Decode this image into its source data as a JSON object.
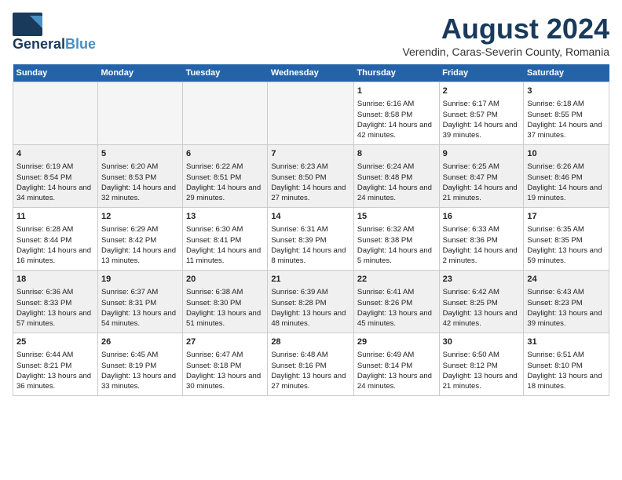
{
  "logo": {
    "general": "General",
    "blue": "Blue"
  },
  "title": "August 2024",
  "subtitle": "Verendin, Caras-Severin County, Romania",
  "days": [
    "Sunday",
    "Monday",
    "Tuesday",
    "Wednesday",
    "Thursday",
    "Friday",
    "Saturday"
  ],
  "weeks": [
    [
      {
        "day": "",
        "content": ""
      },
      {
        "day": "",
        "content": ""
      },
      {
        "day": "",
        "content": ""
      },
      {
        "day": "",
        "content": ""
      },
      {
        "day": "1",
        "content": "Sunrise: 6:16 AM\nSunset: 8:58 PM\nDaylight: 14 hours and 42 minutes."
      },
      {
        "day": "2",
        "content": "Sunrise: 6:17 AM\nSunset: 8:57 PM\nDaylight: 14 hours and 39 minutes."
      },
      {
        "day": "3",
        "content": "Sunrise: 6:18 AM\nSunset: 8:55 PM\nDaylight: 14 hours and 37 minutes."
      }
    ],
    [
      {
        "day": "4",
        "content": "Sunrise: 6:19 AM\nSunset: 8:54 PM\nDaylight: 14 hours and 34 minutes."
      },
      {
        "day": "5",
        "content": "Sunrise: 6:20 AM\nSunset: 8:53 PM\nDaylight: 14 hours and 32 minutes."
      },
      {
        "day": "6",
        "content": "Sunrise: 6:22 AM\nSunset: 8:51 PM\nDaylight: 14 hours and 29 minutes."
      },
      {
        "day": "7",
        "content": "Sunrise: 6:23 AM\nSunset: 8:50 PM\nDaylight: 14 hours and 27 minutes."
      },
      {
        "day": "8",
        "content": "Sunrise: 6:24 AM\nSunset: 8:48 PM\nDaylight: 14 hours and 24 minutes."
      },
      {
        "day": "9",
        "content": "Sunrise: 6:25 AM\nSunset: 8:47 PM\nDaylight: 14 hours and 21 minutes."
      },
      {
        "day": "10",
        "content": "Sunrise: 6:26 AM\nSunset: 8:46 PM\nDaylight: 14 hours and 19 minutes."
      }
    ],
    [
      {
        "day": "11",
        "content": "Sunrise: 6:28 AM\nSunset: 8:44 PM\nDaylight: 14 hours and 16 minutes."
      },
      {
        "day": "12",
        "content": "Sunrise: 6:29 AM\nSunset: 8:42 PM\nDaylight: 14 hours and 13 minutes."
      },
      {
        "day": "13",
        "content": "Sunrise: 6:30 AM\nSunset: 8:41 PM\nDaylight: 14 hours and 11 minutes."
      },
      {
        "day": "14",
        "content": "Sunrise: 6:31 AM\nSunset: 8:39 PM\nDaylight: 14 hours and 8 minutes."
      },
      {
        "day": "15",
        "content": "Sunrise: 6:32 AM\nSunset: 8:38 PM\nDaylight: 14 hours and 5 minutes."
      },
      {
        "day": "16",
        "content": "Sunrise: 6:33 AM\nSunset: 8:36 PM\nDaylight: 14 hours and 2 minutes."
      },
      {
        "day": "17",
        "content": "Sunrise: 6:35 AM\nSunset: 8:35 PM\nDaylight: 13 hours and 59 minutes."
      }
    ],
    [
      {
        "day": "18",
        "content": "Sunrise: 6:36 AM\nSunset: 8:33 PM\nDaylight: 13 hours and 57 minutes."
      },
      {
        "day": "19",
        "content": "Sunrise: 6:37 AM\nSunset: 8:31 PM\nDaylight: 13 hours and 54 minutes."
      },
      {
        "day": "20",
        "content": "Sunrise: 6:38 AM\nSunset: 8:30 PM\nDaylight: 13 hours and 51 minutes."
      },
      {
        "day": "21",
        "content": "Sunrise: 6:39 AM\nSunset: 8:28 PM\nDaylight: 13 hours and 48 minutes."
      },
      {
        "day": "22",
        "content": "Sunrise: 6:41 AM\nSunset: 8:26 PM\nDaylight: 13 hours and 45 minutes."
      },
      {
        "day": "23",
        "content": "Sunrise: 6:42 AM\nSunset: 8:25 PM\nDaylight: 13 hours and 42 minutes."
      },
      {
        "day": "24",
        "content": "Sunrise: 6:43 AM\nSunset: 8:23 PM\nDaylight: 13 hours and 39 minutes."
      }
    ],
    [
      {
        "day": "25",
        "content": "Sunrise: 6:44 AM\nSunset: 8:21 PM\nDaylight: 13 hours and 36 minutes."
      },
      {
        "day": "26",
        "content": "Sunrise: 6:45 AM\nSunset: 8:19 PM\nDaylight: 13 hours and 33 minutes."
      },
      {
        "day": "27",
        "content": "Sunrise: 6:47 AM\nSunset: 8:18 PM\nDaylight: 13 hours and 30 minutes."
      },
      {
        "day": "28",
        "content": "Sunrise: 6:48 AM\nSunset: 8:16 PM\nDaylight: 13 hours and 27 minutes."
      },
      {
        "day": "29",
        "content": "Sunrise: 6:49 AM\nSunset: 8:14 PM\nDaylight: 13 hours and 24 minutes."
      },
      {
        "day": "30",
        "content": "Sunrise: 6:50 AM\nSunset: 8:12 PM\nDaylight: 13 hours and 21 minutes."
      },
      {
        "day": "31",
        "content": "Sunrise: 6:51 AM\nSunset: 8:10 PM\nDaylight: 13 hours and 18 minutes."
      }
    ]
  ]
}
